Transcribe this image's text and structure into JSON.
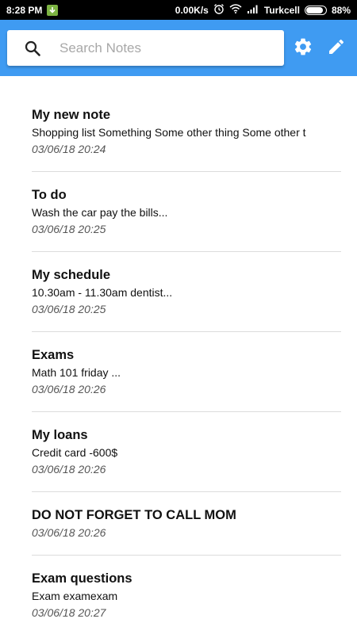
{
  "status_bar": {
    "time": "8:28 PM",
    "speed": "0.00K/s",
    "carrier": "Turkcell",
    "battery": "88%",
    "battery_level": 0.88
  },
  "header": {
    "search_placeholder": "Search Notes",
    "accent_color": "#3f9bf2"
  },
  "notes": [
    {
      "title": "My new note",
      "body": "Shopping list Something Some other thing Some other t",
      "date": "03/06/18 20:24"
    },
    {
      "title": "To do",
      "body": "Wash the car pay the bills...",
      "date": "03/06/18 20:25"
    },
    {
      "title": "My schedule",
      "body": "10.30am - 11.30am dentist...",
      "date": "03/06/18 20:25"
    },
    {
      "title": "Exams",
      "body": "Math 101 friday ...",
      "date": "03/06/18 20:26"
    },
    {
      "title": "My loans",
      "body": "Credit card -600$",
      "date": "03/06/18 20:26"
    },
    {
      "title": "DO NOT FORGET TO CALL MOM",
      "body": "",
      "date": "03/06/18 20:26"
    },
    {
      "title": "Exam questions",
      "body": "Exam examexam",
      "date": "03/06/18 20:27"
    }
  ]
}
